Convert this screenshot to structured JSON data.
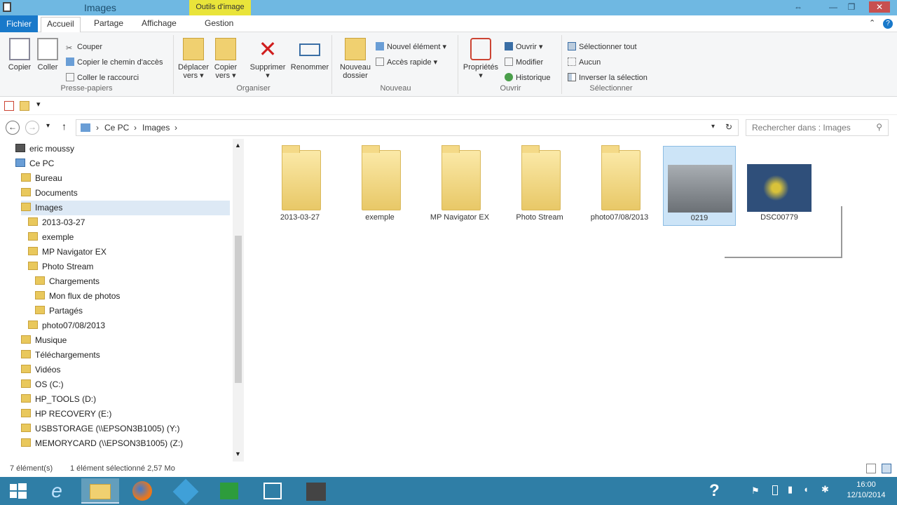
{
  "window": {
    "title": "Images",
    "context_tab": "Outils d'image"
  },
  "ribbon_tabs": [
    "Fichier",
    "Accueil",
    "Partage",
    "Affichage",
    "Gestion"
  ],
  "ribbon": {
    "clipboard": {
      "label": "Presse-papiers",
      "copy": "Copier",
      "paste": "Coller",
      "cut": "Couper",
      "copy_path": "Copier le chemin d'accès",
      "paste_shortcut": "Coller le raccourci"
    },
    "organize": {
      "label": "Organiser",
      "move_to": "Déplacer vers",
      "copy_to": "Copier vers",
      "delete": "Supprimer",
      "rename": "Renommer"
    },
    "new": {
      "label": "Nouveau",
      "new_folder": "Nouveau dossier",
      "new_item": "Nouvel élément",
      "easy_access": "Accès rapide"
    },
    "open": {
      "label": "Ouvrir",
      "properties": "Propriétés",
      "open": "Ouvrir",
      "edit": "Modifier",
      "history": "Historique"
    },
    "select": {
      "label": "Sélectionner",
      "select_all": "Sélectionner tout",
      "select_none": "Aucun",
      "invert": "Inverser la sélection"
    }
  },
  "address": {
    "crumbs": [
      "Ce PC",
      "Images"
    ],
    "search_placeholder": "Rechercher dans : Images"
  },
  "nav_tree": [
    {
      "label": "eric moussy",
      "indent": 0
    },
    {
      "label": "Ce PC",
      "indent": 0
    },
    {
      "label": "Bureau",
      "indent": 1
    },
    {
      "label": "Documents",
      "indent": 1
    },
    {
      "label": "Images",
      "indent": 1
    },
    {
      "label": "2013-03-27",
      "indent": 2
    },
    {
      "label": "exemple",
      "indent": 2
    },
    {
      "label": "MP Navigator EX",
      "indent": 2
    },
    {
      "label": "Photo Stream",
      "indent": 2
    },
    {
      "label": "Chargements",
      "indent": 3
    },
    {
      "label": "Mon flux de photos",
      "indent": 3
    },
    {
      "label": "Partagés",
      "indent": 3
    },
    {
      "label": "photo07/08/2013",
      "indent": 2
    },
    {
      "label": "Musique",
      "indent": 1
    },
    {
      "label": "Téléchargements",
      "indent": 1
    },
    {
      "label": "Vidéos",
      "indent": 1
    },
    {
      "label": "OS (C:)",
      "indent": 1
    },
    {
      "label": "HP_TOOLS (D:)",
      "indent": 1
    },
    {
      "label": "HP RECOVERY (E:)",
      "indent": 1
    },
    {
      "label": "USBSTORAGE (\\\\EPSON3B1005) (Y:)",
      "indent": 1
    },
    {
      "label": "MEMORYCARD (\\\\EPSON3B1005) (Z:)",
      "indent": 1
    }
  ],
  "files": [
    {
      "name": "2013-03-27",
      "type": "folder"
    },
    {
      "name": "exemple",
      "type": "folder"
    },
    {
      "name": "MP Navigator EX",
      "type": "folder"
    },
    {
      "name": "Photo Stream",
      "type": "folder"
    },
    {
      "name": "photo07/08/2013",
      "type": "folder"
    },
    {
      "name": "0219",
      "type": "image"
    },
    {
      "name": "DSC00779",
      "type": "image"
    }
  ],
  "status": {
    "count": "7 élément(s)",
    "selection": "1 élément sélectionné  2,57 Mo"
  },
  "taskbar": {
    "time": "16:00",
    "date": "12/10/2014"
  }
}
